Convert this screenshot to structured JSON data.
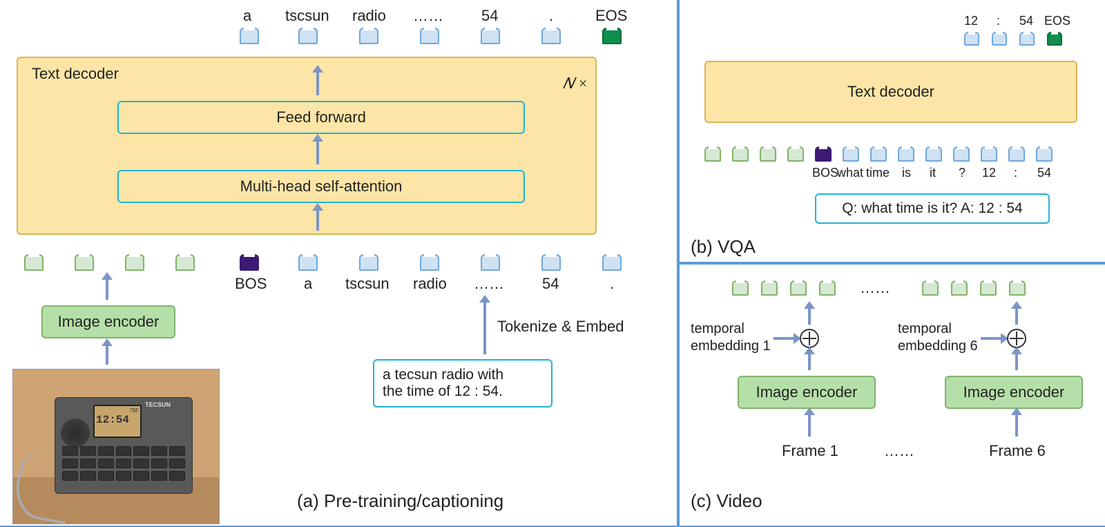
{
  "panel_a": {
    "caption": "(a) Pre-training/captioning",
    "text_decoder_label": "Text decoder",
    "feed_forward": "Feed forward",
    "self_attention": "Multi-head self-attention",
    "n_times": "𝑁 ×",
    "image_encoder": "Image encoder",
    "tokenize_embed": "Tokenize & Embed",
    "input_caption_line1": "a tecsun radio with",
    "input_caption_line2": "the time of 12 : 54.",
    "output_tokens": [
      "a",
      "tscsun",
      "radio",
      "……",
      "54",
      ".",
      "EOS"
    ],
    "input_token_labels": [
      "BOS",
      "a",
      "tscsun",
      "radio",
      "……",
      "54",
      "."
    ],
    "radio_brand": "TECSUN",
    "radio_time": "12:54",
    "radio_temp": "79F"
  },
  "panel_b": {
    "caption": "(b) VQA",
    "text_decoder": "Text decoder",
    "qa_text": "Q: what time is it? A: 12 : 54",
    "output_tokens": [
      "12",
      ":",
      "54",
      "EOS"
    ],
    "input_token_labels": [
      "BOS",
      "what",
      "time",
      "is",
      "it",
      "?",
      "12",
      ":",
      "54"
    ]
  },
  "panel_c": {
    "caption": "(c) Video",
    "temporal1_line1": "temporal",
    "temporal1_line2": "embedding 1",
    "temporal6_line1": "temporal",
    "temporal6_line2": "embedding 6",
    "image_encoder": "Image encoder",
    "frame1": "Frame 1",
    "frame6": "Frame 6",
    "dots": "……",
    "dots2": "……"
  }
}
